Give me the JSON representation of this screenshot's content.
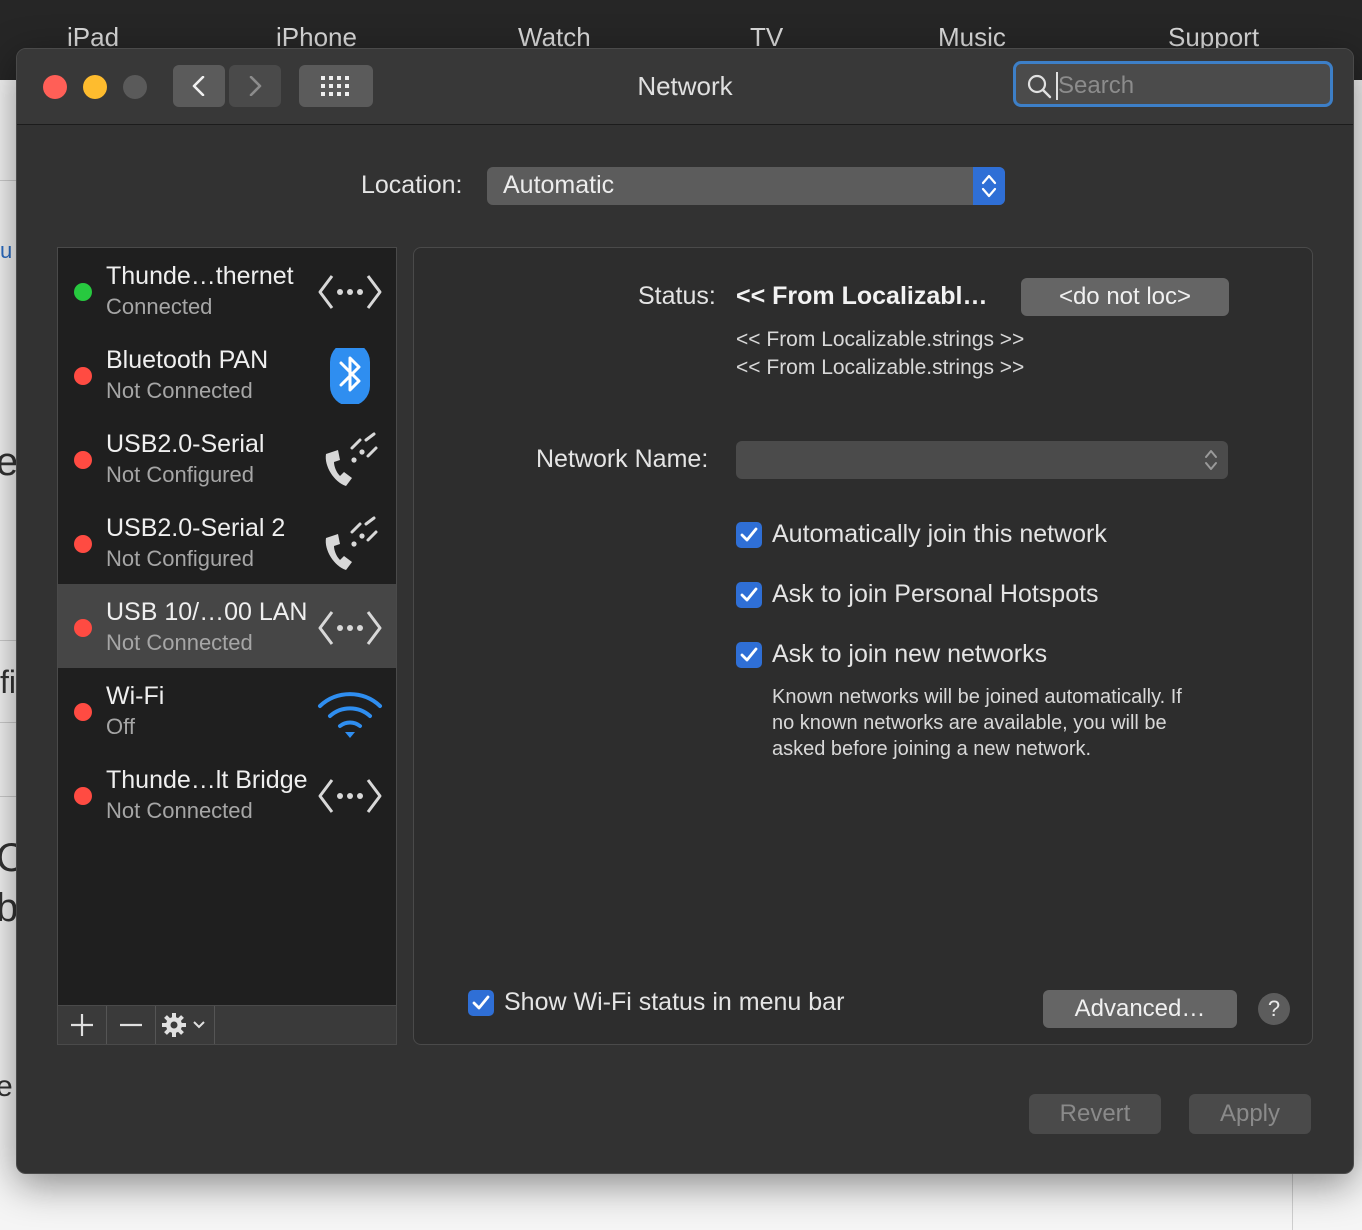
{
  "background_page": {
    "nav_items": [
      "iPad",
      "iPhone",
      "Watch",
      "TV",
      "Music",
      "Support"
    ],
    "edge_letters": [
      "u",
      "e",
      "fi",
      "C",
      "b",
      "e"
    ]
  },
  "window": {
    "title": "Network",
    "search_placeholder": "Search"
  },
  "location": {
    "label": "Location:",
    "value": "Automatic"
  },
  "services": [
    {
      "name": "Thunde…thernet",
      "status": "Connected",
      "dot_color": "#27c93f",
      "icon": "ethernet-icon"
    },
    {
      "name": "Bluetooth PAN",
      "status": "Not Connected",
      "dot_color": "#ff4b42",
      "icon": "bluetooth-icon"
    },
    {
      "name": "USB2.0-Serial",
      "status": "Not Configured",
      "dot_color": "#ff4b42",
      "icon": "phone-modem-icon"
    },
    {
      "name": "USB2.0-Serial 2",
      "status": "Not Configured",
      "dot_color": "#ff4b42",
      "icon": "phone-modem-icon"
    },
    {
      "name": "USB 10/…00 LAN",
      "status": "Not Connected",
      "dot_color": "#ff4b42",
      "icon": "ethernet-icon",
      "selected": true
    },
    {
      "name": "Wi-Fi",
      "status": "Off",
      "dot_color": "#ff4b42",
      "icon": "wifi-icon"
    },
    {
      "name": "Thunde…lt Bridge",
      "status": "Not Connected",
      "dot_color": "#ff4b42",
      "icon": "ethernet-icon"
    }
  ],
  "detail": {
    "status_label": "Status:",
    "status_value": "<< From Localizabl…",
    "status_button": "<do not loc>",
    "status_line1": "<< From Localizable.strings >>",
    "status_line2": "<< From Localizable.strings >>",
    "network_name_label": "Network Name:",
    "checkboxes": [
      {
        "label": "Automatically join this network",
        "checked": true
      },
      {
        "label": "Ask to join Personal Hotspots",
        "checked": true
      },
      {
        "label": "Ask to join new networks",
        "checked": true
      }
    ],
    "help_lines": [
      "Known networks will be joined automatically. If",
      "no known networks are available, you will be",
      "asked before joining a new network."
    ],
    "show_wifi_label": "Show Wi-Fi status in menu bar",
    "advanced_button": "Advanced…",
    "help_glyph": "?"
  },
  "footer": {
    "revert": "Revert",
    "apply": "Apply"
  }
}
